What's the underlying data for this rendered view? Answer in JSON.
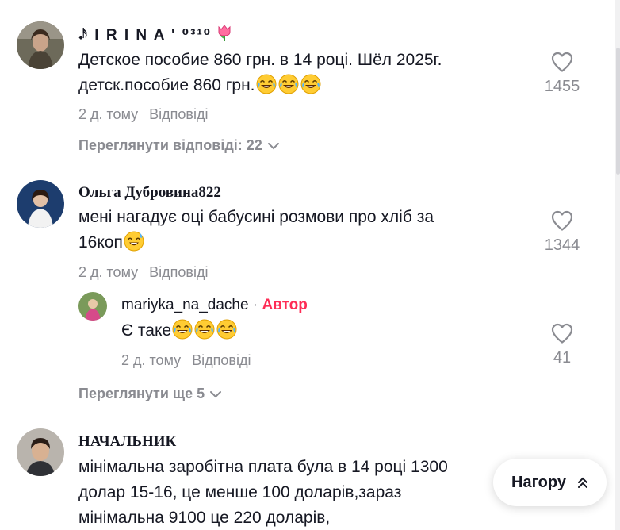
{
  "comments": [
    {
      "username": "𝆺𝅥𝅯 I R I N A ' ⁰³¹⁰",
      "text_lines": [
        "Детское пособие 860 грн. в 14 році. Шёл 2025г.",
        "детск.пособие 860 грн."
      ],
      "line2_emojis": [
        "joy-emoji",
        "joy-emoji",
        "joy-emoji"
      ],
      "time": "2 д. тому",
      "reply_label": "Відповіді",
      "likes": "1455",
      "view_replies": "Переглянути відповіді: 22"
    },
    {
      "username": "Ольга Дубровина822",
      "text_lines": [
        "мені нагадує оці бабусині розмови про хліб за",
        "16коп"
      ],
      "line2_emojis": [
        "sweat-smile-emoji"
      ],
      "time": "2 д. тому",
      "reply_label": "Відповіді",
      "likes": "1344",
      "reply": {
        "username": "mariyka_na_dache",
        "separator": "·",
        "badge": "Автор",
        "text": "Є таке",
        "emojis": [
          "joy-emoji",
          "joy-emoji",
          "joy-emoji"
        ],
        "time": "2 д. тому",
        "reply_label": "Відповіді",
        "likes": "41"
      },
      "view_more": "Переглянути ще 5"
    },
    {
      "username": "НАЧАЛЬНИК",
      "text_lines": [
        "мінімальна заробітна плата була в 14 році 1300",
        "долар 15-16, це менше 100 доларів,зараз",
        "мінімальна 9100 це 220 доларів,"
      ]
    }
  ],
  "scroll_top": {
    "label": "Нагору",
    "icon": "double-chevron-up-icon"
  },
  "colors": {
    "text": "#161823",
    "muted": "#8a8b91",
    "accent": "#fe2c55"
  }
}
